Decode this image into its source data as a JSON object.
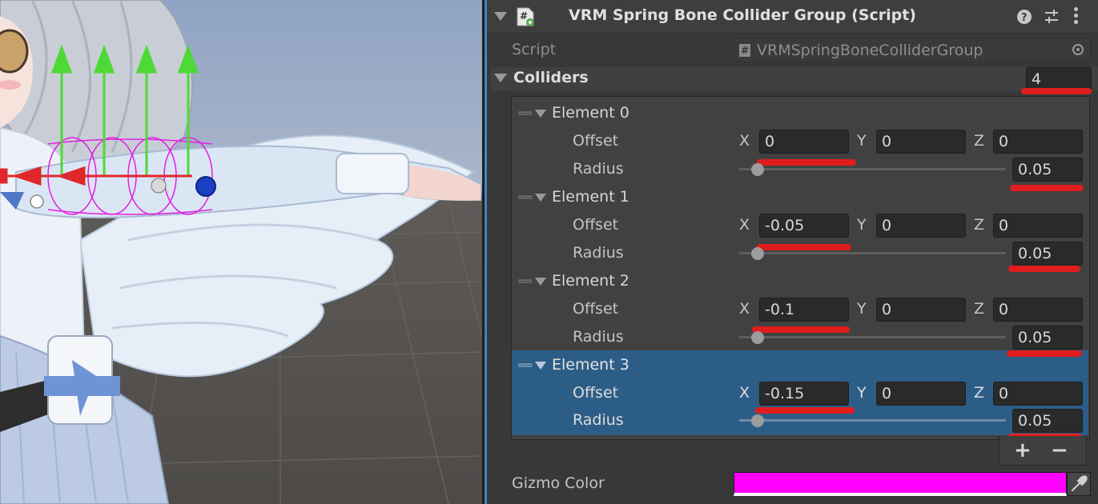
{
  "inspector": {
    "title": "VRM Spring Bone Collider Group (Script)",
    "script_label": "Script",
    "script_value": "VRMSpringBoneColliderGroup",
    "colliders_label": "Colliders",
    "colliders_count": "4",
    "elements": [
      {
        "name": "Element 0",
        "offset_label": "Offset",
        "x": "0",
        "y": "0",
        "z": "0",
        "radius_label": "Radius",
        "radius": "0.05",
        "selected": false
      },
      {
        "name": "Element 1",
        "offset_label": "Offset",
        "x": "-0.05",
        "y": "0",
        "z": "0",
        "radius_label": "Radius",
        "radius": "0.05",
        "selected": false
      },
      {
        "name": "Element 2",
        "offset_label": "Offset",
        "x": "-0.1",
        "y": "0",
        "z": "0",
        "radius_label": "Radius",
        "radius": "0.05",
        "selected": false
      },
      {
        "name": "Element 3",
        "offset_label": "Offset",
        "x": "-0.15",
        "y": "0",
        "z": "0",
        "radius_label": "Radius",
        "radius": "0.05",
        "selected": true
      }
    ],
    "axis_labels": {
      "x": "X",
      "y": "Y",
      "z": "Z"
    },
    "add_symbol": "+",
    "remove_symbol": "−",
    "gizmo_label": "Gizmo Color",
    "gizmo_color": "#ff00ff",
    "header_icons": [
      "help-icon",
      "presets-icon",
      "kebab-menu-icon"
    ],
    "accent_color": "#3d86c4",
    "annotation_color": "#e01d1d"
  }
}
